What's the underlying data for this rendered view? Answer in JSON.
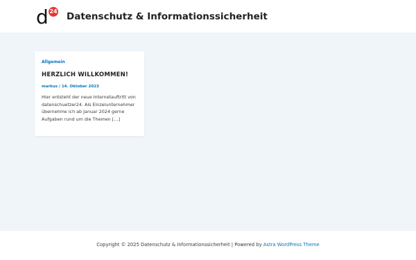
{
  "header": {
    "logo": {
      "letter": "d",
      "badge": "24"
    },
    "site_title": "Datenschutz & Informationssicherheit"
  },
  "post": {
    "category": "Allgemein",
    "title": "HERZLICH WILLKOMMEN!",
    "author": "markus",
    "meta_separator": " / ",
    "date": "14. Oktober 2023",
    "excerpt": "Hier entsteht der neue Internetauftritt von datenschuetzer24. Als Einzelunternehmer übernehme ich ab Januar 2024 gerne Aufgaben rund um die Themen […]"
  },
  "footer": {
    "copyright": "Copyright © 2025 Datenschutz & Informationssicherheit | Powered by ",
    "theme_link": "Astra WordPress Theme"
  },
  "colors": {
    "accent": "#0274be",
    "background": "#f0f5fa",
    "logo_badge": "#e53935"
  }
}
